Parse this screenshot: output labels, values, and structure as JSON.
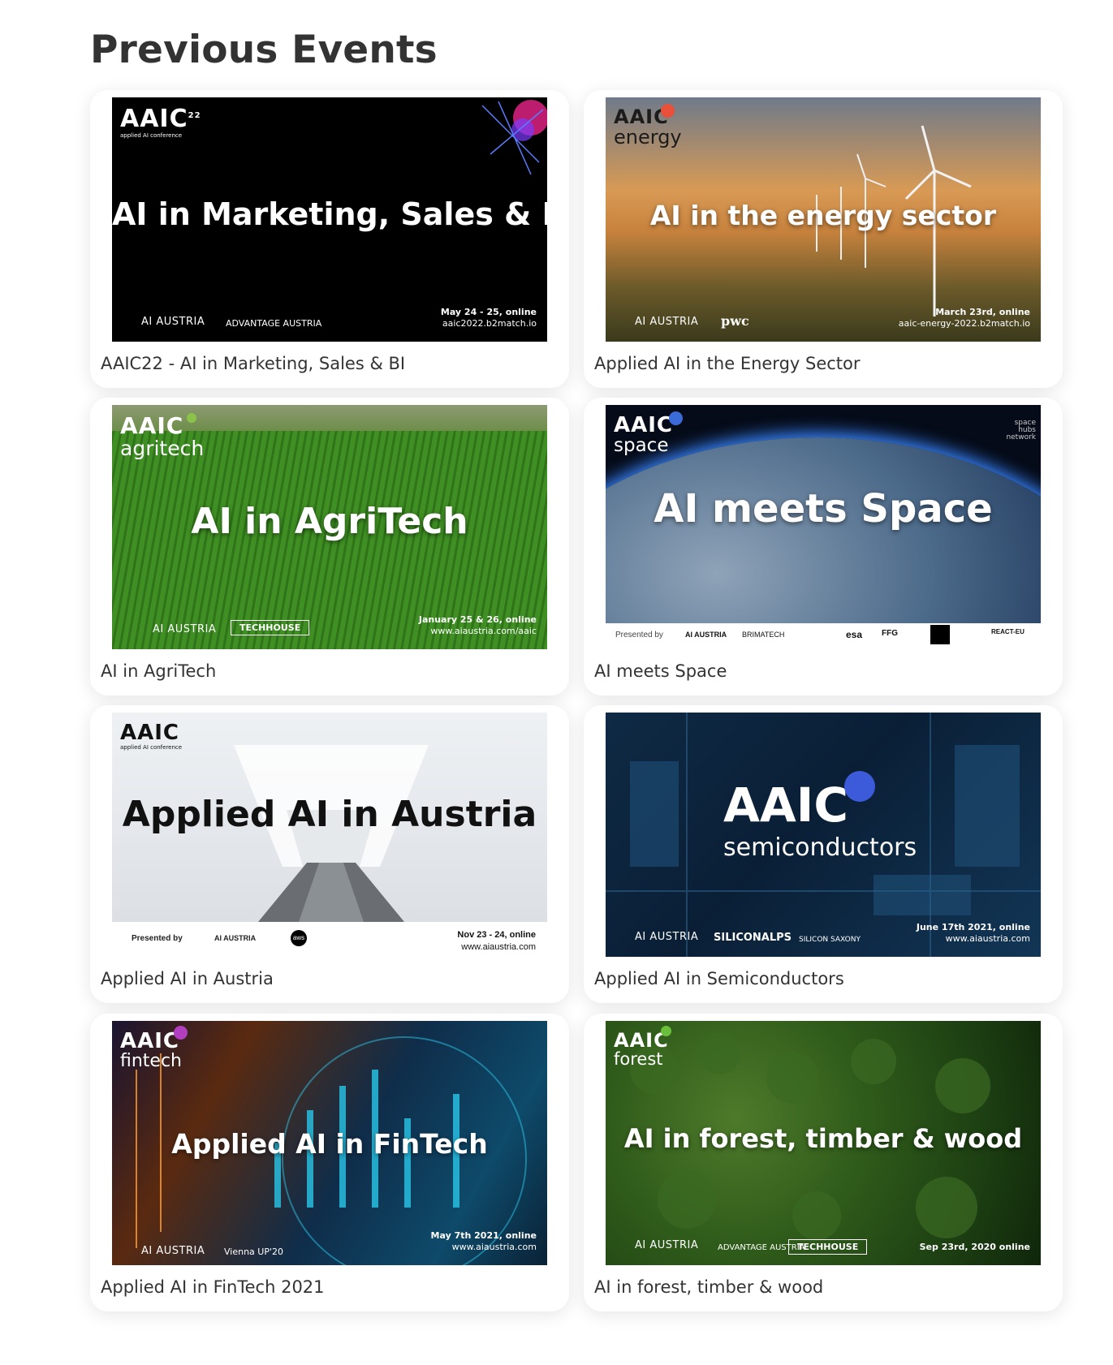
{
  "page": {
    "title": "Previous Events"
  },
  "events": [
    {
      "caption": "AAIC22 - AI in Marketing, Sales & BI",
      "logo": "AAIC",
      "logo_sup": "22",
      "logo_sub": "applied AI conference",
      "headline": "AI in Marketing, Sales & BI",
      "org": "AI AUSTRIA",
      "partner": "ADVANTAGE AUSTRIA",
      "date": "May 24 - 25, online",
      "url": "aaic2022.b2match.io"
    },
    {
      "caption": "Applied AI in the Energy Sector",
      "logo": "AAIC",
      "logo_sub": "energy",
      "headline": "AI in the energy sector",
      "org": "AI AUSTRIA",
      "partner": "pwc",
      "date": "March 23rd, online",
      "url": "aaic-energy-2022.b2match.io"
    },
    {
      "caption": "AI in AgriTech",
      "logo": "AAIC",
      "logo_sub": "agritech",
      "headline": "AI in AgriTech",
      "org": "AI AUSTRIA",
      "partner": "TECHHOUSE",
      "date": "January 25 & 26, online",
      "url": "www.aiaustria.com/aaic"
    },
    {
      "caption": "AI meets Space",
      "logo": "AAIC",
      "logo_sub": "space",
      "corner": "space hubs network",
      "headline": "AI meets Space",
      "presented": "Presented by",
      "org": "AI AUSTRIA",
      "partner": "BRIMATECH",
      "sponsor1": "esa",
      "sponsor2": "FFG",
      "sponsor3": "REACT-EU"
    },
    {
      "caption": "Applied AI in Austria",
      "logo": "AAIC",
      "logo_sub": "applied AI conference",
      "headline": "Applied AI in Austria",
      "presented": "Presented by",
      "org": "AI AUSTRIA",
      "partner": "aws",
      "date": "Nov 23 - 24, online",
      "url": "www.aiaustria.com"
    },
    {
      "caption": "Applied AI in Semiconductors",
      "logo": "AAIC",
      "logo_sub": "semiconductors",
      "org": "AI AUSTRIA",
      "partner": "SILICONALPS",
      "partner2": "SILICON SAXONY",
      "date": "June 17th 2021, online",
      "url": "www.aiaustria.com"
    },
    {
      "caption": "Applied AI in FinTech 2021",
      "logo": "AAIC",
      "logo_sub": "fintech",
      "headline": "Applied AI in FinTech",
      "org": "AI AUSTRIA",
      "partner": "Vienna UP'20",
      "date": "May 7th 2021, online",
      "url": "www.aiaustria.com"
    },
    {
      "caption": "AI in forest, timber & wood",
      "logo": "AAIC",
      "logo_sub": "forest",
      "headline": "AI in forest, timber & wood",
      "org": "AI AUSTRIA",
      "partner": "ADVANTAGE AUSTRIA",
      "partner2": "TECHHOUSE",
      "date": "Sep 23rd, 2020 online"
    }
  ],
  "colors": {
    "card_bg": "#ffffff",
    "title": "#333333",
    "energy_badge": "#e8503a",
    "space_badge": "#3a6bd8",
    "semi_badge": "#3b5bdb",
    "agri_badge": "#8bc34a",
    "fintech_badge": "#b23fbf",
    "forest_badge": "#6bbf3a"
  }
}
